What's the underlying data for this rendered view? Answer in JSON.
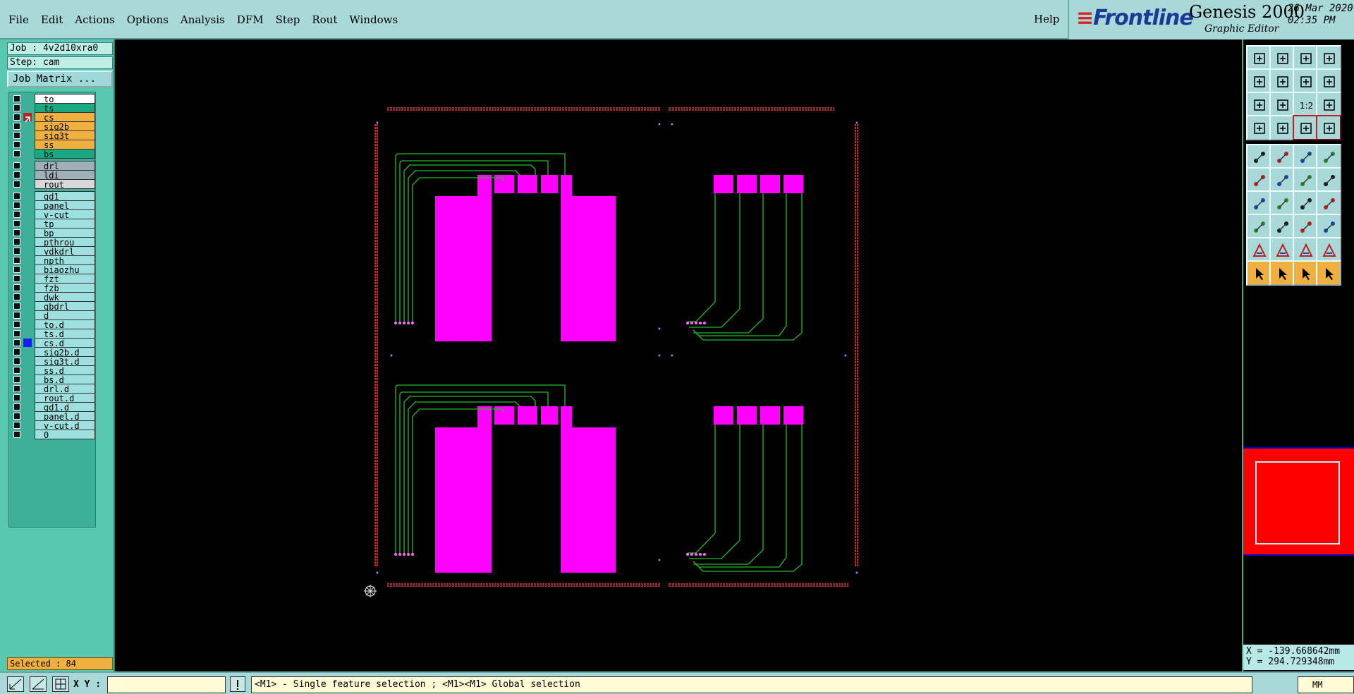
{
  "menu": {
    "items": [
      "File",
      "Edit",
      "Actions",
      "Options",
      "Analysis",
      "DFM",
      "Step",
      "Rout",
      "Windows"
    ],
    "help": "Help"
  },
  "brand": {
    "logo": "Frontline",
    "product": "Genesis 2000",
    "subtitle": "Graphic Editor",
    "date": "26 Mar 2020",
    "time": "02:35 PM"
  },
  "job": {
    "job": "Job : 4v2d10xra0",
    "step": "Step: cam",
    "matrix_button": "Job Matrix ..."
  },
  "layers": {
    "group1": [
      {
        "name": "to",
        "color": "#ffffff"
      },
      {
        "name": "ts",
        "color": "#1aa883"
      },
      {
        "name": "cs",
        "color": "#f0b040"
      },
      {
        "name": "sig2b",
        "color": "#f0b040"
      },
      {
        "name": "sig3t",
        "color": "#f0b040"
      },
      {
        "name": "ss",
        "color": "#f0b040"
      },
      {
        "name": "bs",
        "color": "#1aa883"
      }
    ],
    "group2": [
      {
        "name": "drl",
        "color": "#a0b0b8"
      },
      {
        "name": "ldi",
        "color": "#a0b0b8"
      },
      {
        "name": "rout",
        "color": "#d8d8d8"
      }
    ],
    "group3": [
      "gd1",
      "panel",
      "v-cut",
      "tp",
      "bp",
      "pthrou",
      "ydkdrl",
      "npth",
      "biaozhu",
      "fzt",
      "fzb",
      "dwk",
      "gbdrl",
      "d",
      "to.d",
      "ts.d",
      "cs.d",
      "sig2b.d",
      "sig3t.d",
      "ss.d",
      "bs.d",
      "drl.d",
      "rout.d",
      "gd1.d",
      "panel.d",
      "v-cut.d",
      "0"
    ],
    "group3_color": "#9ee0e0"
  },
  "selected": "Selected : 84",
  "coords": {
    "x": "X = -139.668642mm",
    "y": "Y = 294.729348mm"
  },
  "status": {
    "xy_label": "X Y :",
    "message": "<M1> - Single feature selection ; <M1><M1> Global selection",
    "units": "MM"
  },
  "colors": {
    "pad": "#ff00ff",
    "trace": "#22bb22",
    "drill_border": "#cc2222",
    "minimap": "#ff0000"
  },
  "tools": {
    "icons": [
      [
        "layer-up-icon",
        "layer-down-icon",
        "home-icon",
        "window-icon"
      ],
      [
        "zoom-left-icon",
        "zoom-right-icon",
        "toggle-icon",
        "redraw-icon"
      ],
      [
        "zoom-fit-icon",
        "zoom-center-icon",
        "scale-icon",
        "query-icon"
      ],
      [
        "measure-icon",
        "snap-icon",
        "net-icon",
        "net2-icon"
      ],
      [
        "add-pad-icon",
        "add-surface-icon",
        "ruler-icon",
        "circle-icon"
      ],
      [
        "connect-icon",
        "break-icon",
        "line-icon",
        "arc-icon"
      ],
      [
        "angle-icon",
        "slope-icon",
        "rotate-icon",
        "flip-icon"
      ],
      [
        "move-icon",
        "cut-icon",
        "mirror-icon",
        "copy-icon"
      ],
      [
        "triangle-icon",
        "text-a-icon",
        "text-a2-icon",
        "text-a3-icon"
      ],
      [
        "pointer-icon",
        "pointer2-icon",
        "pointer3-icon",
        "pointer4-icon"
      ]
    ],
    "scale_label": "1:2"
  }
}
